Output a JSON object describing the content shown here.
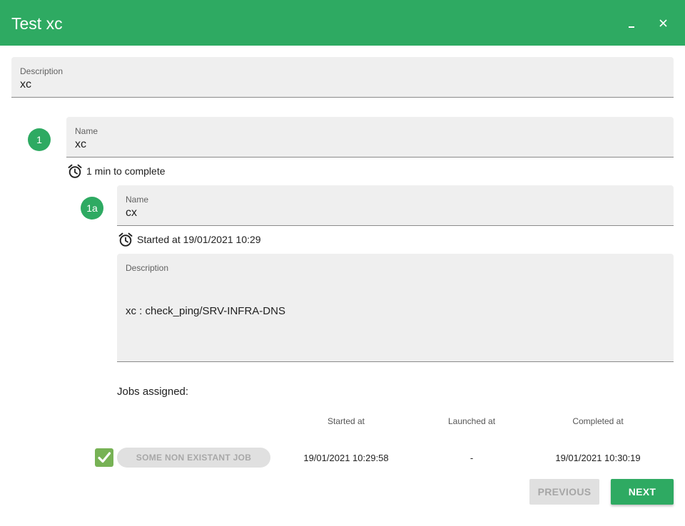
{
  "window": {
    "title": "Test xc",
    "minimize_label": "_",
    "close_icon": "close-icon",
    "accent_color": "#2eaa62"
  },
  "description_field": {
    "label": "Description",
    "value": "xc"
  },
  "step1": {
    "badge": "1",
    "name_field": {
      "label": "Name",
      "value": "xc"
    },
    "timer_text": "1 min to complete",
    "timer_icon": "alarm-clock-icon"
  },
  "step1a": {
    "badge": "1a",
    "name_field": {
      "label": "Name",
      "value": "cx"
    },
    "timer_text": "Started at 19/01/2021 10:29",
    "timer_icon": "alarm-clock-icon",
    "description_field": {
      "label": "Description",
      "value": "xc : check_ping/SRV-INFRA-DNS"
    }
  },
  "jobs": {
    "title": "Jobs assigned:",
    "columns": [
      "Started at",
      "Launched at",
      "Completed at"
    ],
    "rows": [
      {
        "status_icon": "check-mark-icon",
        "name": "SOME NON EXISTANT JOB",
        "started_at": "19/01/2021 10:29:58",
        "launched_at": "-",
        "completed_at": "19/01/2021 10:30:19"
      }
    ]
  },
  "footer": {
    "previous_label": "PREVIOUS",
    "next_label": "NEXT"
  }
}
